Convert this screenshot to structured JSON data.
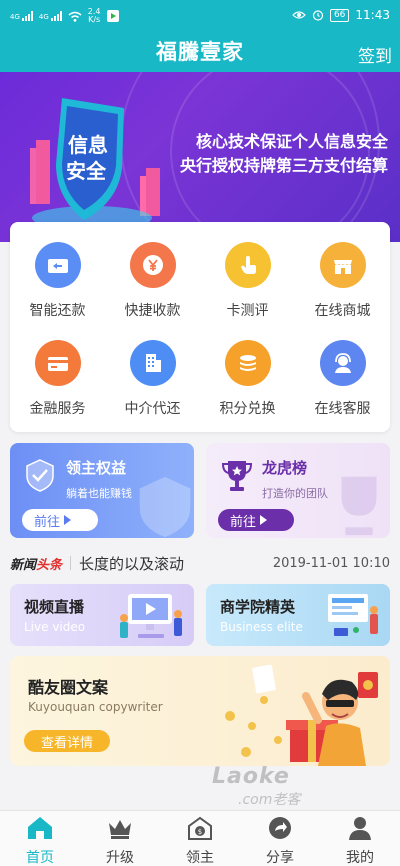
{
  "status": {
    "signal1": "4G",
    "signal2": "4G",
    "speed": "2.4",
    "speed_unit": "K/s",
    "battery": "66",
    "time": "11:43"
  },
  "header": {
    "title": "福騰壹家",
    "signin": "签到"
  },
  "banner": {
    "line1": "核心技术保证个人信息安全",
    "line2": "央行授权持牌第三方支付结算",
    "shield_text_top": "信息",
    "shield_text_bottom": "安全"
  },
  "grid": [
    {
      "label": "智能还款",
      "icon": "repayment-card-icon",
      "color": "#5b8ef5"
    },
    {
      "label": "快捷收款",
      "icon": "yen-coin-icon",
      "color": "#f3774a"
    },
    {
      "label": "卡测评",
      "icon": "tap-hand-icon",
      "color": "#f6c231"
    },
    {
      "label": "在线商城",
      "icon": "shop-icon",
      "color": "#f6b13a"
    },
    {
      "label": "金融服务",
      "icon": "finance-card-icon",
      "color": "#f37a3b"
    },
    {
      "label": "中介代还",
      "icon": "building-icon",
      "color": "#4e8df3"
    },
    {
      "label": "积分兑换",
      "icon": "coin-stack-icon",
      "color": "#f6a12a"
    },
    {
      "label": "在线客服",
      "icon": "customer-service-icon",
      "color": "#5e86f0"
    }
  ],
  "promos": {
    "left": {
      "title": "领主权益",
      "subtitle": "躺着也能赚钱",
      "button": "前往"
    },
    "right": {
      "title": "龙虎榜",
      "subtitle": "打造你的团队",
      "button": "前往"
    }
  },
  "news": {
    "logo_a": "新闻",
    "logo_b": "头条",
    "text": "长度的以及滚动",
    "date": "2019-11-01 10:10"
  },
  "features": {
    "left": {
      "title": "视频直播",
      "subtitle": "Live video"
    },
    "right": {
      "title": "商学院精英",
      "subtitle": "Business elite"
    }
  },
  "kyq": {
    "title": "酷友圈文案",
    "subtitle": "Kuyouquan copywriter",
    "button": "查看详情"
  },
  "watermark": {
    "a": "Laoke",
    "b": ".com老客"
  },
  "tabs": [
    {
      "label": "首页",
      "icon": "home-icon",
      "active": true
    },
    {
      "label": "升级",
      "icon": "crown-icon",
      "active": false
    },
    {
      "label": "领主",
      "icon": "lord-house-icon",
      "active": false
    },
    {
      "label": "分享",
      "icon": "share-icon",
      "active": false
    },
    {
      "label": "我的",
      "icon": "profile-icon",
      "active": false
    }
  ],
  "colors": {
    "primary": "#19b8c6",
    "banner": "#6c2bd9"
  }
}
